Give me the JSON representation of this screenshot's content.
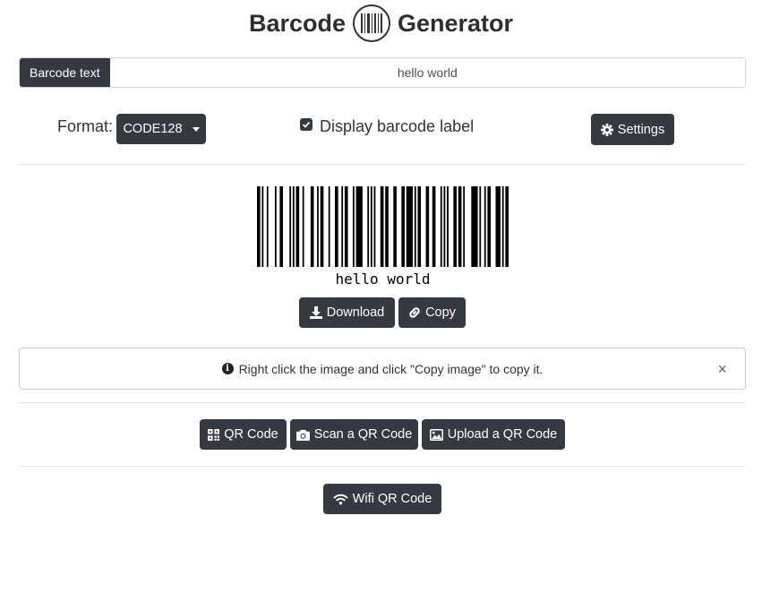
{
  "header": {
    "title_left": "Barcode",
    "title_right": "Generator"
  },
  "input": {
    "label": "Barcode text",
    "value": "hello world"
  },
  "options": {
    "format_label": "Format:",
    "format_selected": "CODE128",
    "display_label_text": "Display barcode label",
    "display_label_checked": true,
    "settings_label": "Settings"
  },
  "barcode": {
    "label": "hello world",
    "bar_pattern": "11010010000100110000101011001000011001011000100011001011000101111000101010001101100011000110111101011000110011000101010001101101000011110100101100011101011"
  },
  "actions": {
    "download_label": "Download",
    "copy_label": "Copy"
  },
  "alert": {
    "text": "Right click the image and click \"Copy image\" to copy it.",
    "close_symbol": "×"
  },
  "qr_buttons": {
    "qr_code": "QR Code",
    "scan": "Scan a QR Code",
    "upload": "Upload a QR Code"
  },
  "wifi": {
    "label": "Wifi QR Code"
  }
}
